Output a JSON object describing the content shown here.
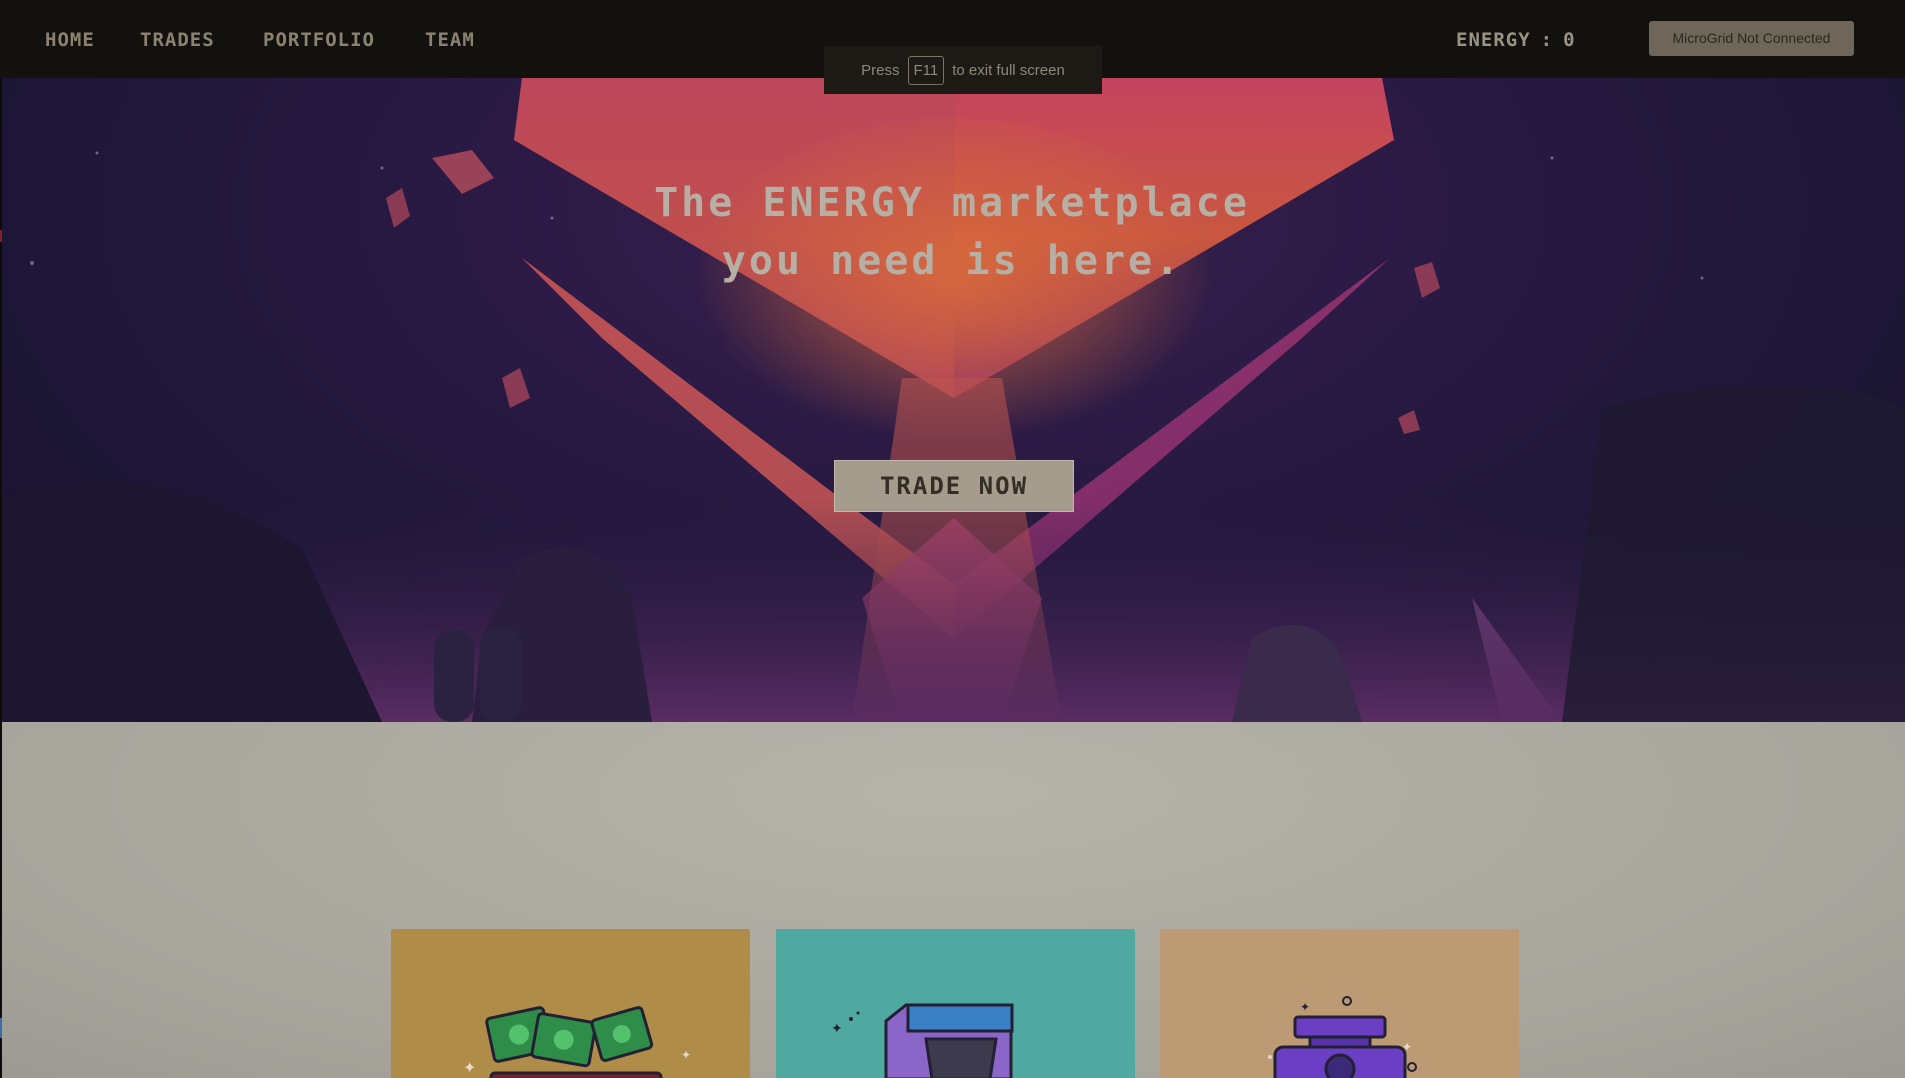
{
  "nav": {
    "items": [
      {
        "label": "HOME"
      },
      {
        "label": "TRADES"
      },
      {
        "label": "PORTFOLIO"
      },
      {
        "label": "TEAM"
      }
    ],
    "energy_label": "ENERGY",
    "energy_separator": ":",
    "energy_value": "0",
    "connect_button_label": "MicroGrid Not Connected"
  },
  "fullscreen_notice": {
    "prefix": "Press",
    "key": "F11",
    "suffix": "to exit full screen"
  },
  "hero": {
    "title_line1": "The ENERGY marketplace",
    "title_line2": "you need is here.",
    "cta_label": "TRADE NOW"
  },
  "cards": [
    {
      "icon": "money-stack-icon",
      "color": "#b08c49"
    },
    {
      "icon": "arcade-machine-icon",
      "color": "#4fa9a0"
    },
    {
      "icon": "weighing-scale-icon",
      "color": "#bc9a74"
    }
  ],
  "colors": {
    "navbar_bg": "#13110e",
    "hero_accent": "#d36a3a",
    "button_bg": "#a69c8d",
    "lower_bg": "#b1afa5"
  }
}
